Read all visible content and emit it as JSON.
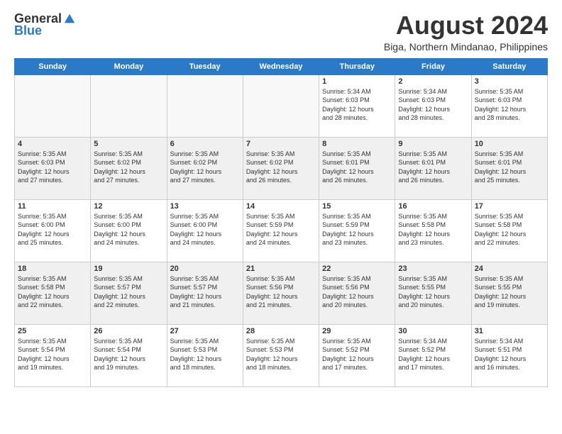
{
  "logo": {
    "general": "General",
    "blue": "Blue"
  },
  "header": {
    "title": "August 2024",
    "subtitle": "Biga, Northern Mindanao, Philippines"
  },
  "weekdays": [
    "Sunday",
    "Monday",
    "Tuesday",
    "Wednesday",
    "Thursday",
    "Friday",
    "Saturday"
  ],
  "weeks": [
    [
      {
        "day": "",
        "info": ""
      },
      {
        "day": "",
        "info": ""
      },
      {
        "day": "",
        "info": ""
      },
      {
        "day": "",
        "info": ""
      },
      {
        "day": "1",
        "info": "Sunrise: 5:34 AM\nSunset: 6:03 PM\nDaylight: 12 hours\nand 28 minutes."
      },
      {
        "day": "2",
        "info": "Sunrise: 5:34 AM\nSunset: 6:03 PM\nDaylight: 12 hours\nand 28 minutes."
      },
      {
        "day": "3",
        "info": "Sunrise: 5:35 AM\nSunset: 6:03 PM\nDaylight: 12 hours\nand 28 minutes."
      }
    ],
    [
      {
        "day": "4",
        "info": "Sunrise: 5:35 AM\nSunset: 6:03 PM\nDaylight: 12 hours\nand 27 minutes."
      },
      {
        "day": "5",
        "info": "Sunrise: 5:35 AM\nSunset: 6:02 PM\nDaylight: 12 hours\nand 27 minutes."
      },
      {
        "day": "6",
        "info": "Sunrise: 5:35 AM\nSunset: 6:02 PM\nDaylight: 12 hours\nand 27 minutes."
      },
      {
        "day": "7",
        "info": "Sunrise: 5:35 AM\nSunset: 6:02 PM\nDaylight: 12 hours\nand 26 minutes."
      },
      {
        "day": "8",
        "info": "Sunrise: 5:35 AM\nSunset: 6:01 PM\nDaylight: 12 hours\nand 26 minutes."
      },
      {
        "day": "9",
        "info": "Sunrise: 5:35 AM\nSunset: 6:01 PM\nDaylight: 12 hours\nand 26 minutes."
      },
      {
        "day": "10",
        "info": "Sunrise: 5:35 AM\nSunset: 6:01 PM\nDaylight: 12 hours\nand 25 minutes."
      }
    ],
    [
      {
        "day": "11",
        "info": "Sunrise: 5:35 AM\nSunset: 6:00 PM\nDaylight: 12 hours\nand 25 minutes."
      },
      {
        "day": "12",
        "info": "Sunrise: 5:35 AM\nSunset: 6:00 PM\nDaylight: 12 hours\nand 24 minutes."
      },
      {
        "day": "13",
        "info": "Sunrise: 5:35 AM\nSunset: 6:00 PM\nDaylight: 12 hours\nand 24 minutes."
      },
      {
        "day": "14",
        "info": "Sunrise: 5:35 AM\nSunset: 5:59 PM\nDaylight: 12 hours\nand 24 minutes."
      },
      {
        "day": "15",
        "info": "Sunrise: 5:35 AM\nSunset: 5:59 PM\nDaylight: 12 hours\nand 23 minutes."
      },
      {
        "day": "16",
        "info": "Sunrise: 5:35 AM\nSunset: 5:58 PM\nDaylight: 12 hours\nand 23 minutes."
      },
      {
        "day": "17",
        "info": "Sunrise: 5:35 AM\nSunset: 5:58 PM\nDaylight: 12 hours\nand 22 minutes."
      }
    ],
    [
      {
        "day": "18",
        "info": "Sunrise: 5:35 AM\nSunset: 5:58 PM\nDaylight: 12 hours\nand 22 minutes."
      },
      {
        "day": "19",
        "info": "Sunrise: 5:35 AM\nSunset: 5:57 PM\nDaylight: 12 hours\nand 22 minutes."
      },
      {
        "day": "20",
        "info": "Sunrise: 5:35 AM\nSunset: 5:57 PM\nDaylight: 12 hours\nand 21 minutes."
      },
      {
        "day": "21",
        "info": "Sunrise: 5:35 AM\nSunset: 5:56 PM\nDaylight: 12 hours\nand 21 minutes."
      },
      {
        "day": "22",
        "info": "Sunrise: 5:35 AM\nSunset: 5:56 PM\nDaylight: 12 hours\nand 20 minutes."
      },
      {
        "day": "23",
        "info": "Sunrise: 5:35 AM\nSunset: 5:55 PM\nDaylight: 12 hours\nand 20 minutes."
      },
      {
        "day": "24",
        "info": "Sunrise: 5:35 AM\nSunset: 5:55 PM\nDaylight: 12 hours\nand 19 minutes."
      }
    ],
    [
      {
        "day": "25",
        "info": "Sunrise: 5:35 AM\nSunset: 5:54 PM\nDaylight: 12 hours\nand 19 minutes."
      },
      {
        "day": "26",
        "info": "Sunrise: 5:35 AM\nSunset: 5:54 PM\nDaylight: 12 hours\nand 19 minutes."
      },
      {
        "day": "27",
        "info": "Sunrise: 5:35 AM\nSunset: 5:53 PM\nDaylight: 12 hours\nand 18 minutes."
      },
      {
        "day": "28",
        "info": "Sunrise: 5:35 AM\nSunset: 5:53 PM\nDaylight: 12 hours\nand 18 minutes."
      },
      {
        "day": "29",
        "info": "Sunrise: 5:35 AM\nSunset: 5:52 PM\nDaylight: 12 hours\nand 17 minutes."
      },
      {
        "day": "30",
        "info": "Sunrise: 5:34 AM\nSunset: 5:52 PM\nDaylight: 12 hours\nand 17 minutes."
      },
      {
        "day": "31",
        "info": "Sunrise: 5:34 AM\nSunset: 5:51 PM\nDaylight: 12 hours\nand 16 minutes."
      }
    ]
  ]
}
